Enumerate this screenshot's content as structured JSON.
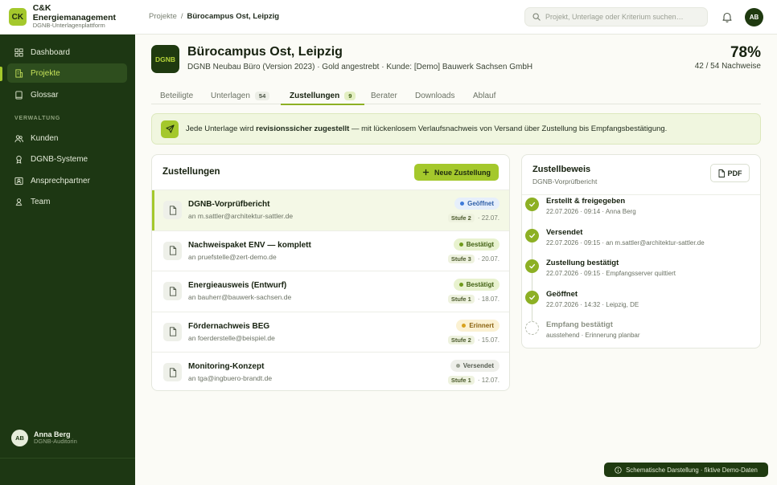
{
  "brand": {
    "logo": "CK",
    "name": "C&K Energiemanagement",
    "subtitle": "DGNB-Unterlagenplattform"
  },
  "breadcrumb": {
    "parent": "Projekte",
    "separator": "/",
    "current": "Bürocampus Ost, Leipzig"
  },
  "search": {
    "placeholder": "Projekt, Unterlage oder Kriterium suchen…",
    "icon": "search-icon"
  },
  "topbar": {
    "avatar": "AB",
    "bell_icon": "bell-icon"
  },
  "sidebar": {
    "items": [
      {
        "label": "Dashboard",
        "icon": "grid-icon"
      },
      {
        "label": "Projekte",
        "icon": "building-icon",
        "active": true
      },
      {
        "label": "Glossar",
        "icon": "book-icon"
      }
    ],
    "section_label": "VERWALTUNG",
    "admin_items": [
      {
        "label": "Kunden",
        "icon": "users-icon"
      },
      {
        "label": "DGNB-Systeme",
        "icon": "award-icon"
      },
      {
        "label": "Ansprechpartner",
        "icon": "contact-card-icon"
      },
      {
        "label": "Team",
        "icon": "user-icon"
      }
    ],
    "user": {
      "initials": "AB",
      "name": "Anna Berg",
      "role": "DGNB-Auditorin"
    }
  },
  "project": {
    "logo": "DGNB",
    "title": "Bürocampus Ost, Leipzig",
    "subtitle": "DGNB Neubau Büro (Version 2023) · Gold angestrebt · Kunde: [Demo] Bauwerk Sachsen GmbH",
    "progress_pct": "78%",
    "progress_value": 0.78,
    "progress_count": "42 / 54 Nachweise"
  },
  "tabs": [
    {
      "label": "Beteiligte",
      "count": ""
    },
    {
      "label": "Unterlagen",
      "count": "54"
    },
    {
      "label": "Zustellungen",
      "count": "9",
      "active": true
    },
    {
      "label": "Berater",
      "count": ""
    },
    {
      "label": "Downloads",
      "count": ""
    },
    {
      "label": "Ablauf",
      "count": ""
    }
  ],
  "banner": {
    "icon": "send-icon",
    "text_before": "Jede Unterlage wird ",
    "text_bold": "revisionssicher zugestellt",
    "text_after": " — mit lückenlosem Verlaufsnachweis von Versand über Zustellung bis Empfangsbestätigung."
  },
  "deliveries": {
    "title": "Zustellungen",
    "new_button": "Neue Zustellung",
    "rows": [
      {
        "title": "DGNB-Vorprüfbericht",
        "recipient": "an m.sattler@architektur-sattler.de",
        "status": "Geöffnet",
        "status_color": "#3f7bd8",
        "status_bg": "#e6effb",
        "status_text": "#2f5fa8",
        "stage": "Stufe 2",
        "date": "· 22.07.",
        "selected": true
      },
      {
        "title": "Nachweispaket ENV — komplett",
        "recipient": "an pruefstelle@zert-demo.de",
        "status": "Bestätigt",
        "status_color": "#6f9a1a",
        "status_bg": "#e8f2cf",
        "status_text": "#3f5f10",
        "stage": "Stufe 3",
        "date": "· 20.07."
      },
      {
        "title": "Energieausweis (Entwurf)",
        "recipient": "an bauherr@bauwerk-sachsen.de",
        "status": "Bestätigt",
        "status_color": "#6f9a1a",
        "status_bg": "#e8f2cf",
        "status_text": "#3f5f10",
        "stage": "Stufe 1",
        "date": "· 18.07."
      },
      {
        "title": "Fördernachweis BEG",
        "recipient": "an foerderstelle@beispiel.de",
        "status": "Erinnert",
        "status_color": "#d8a21f",
        "status_bg": "#fbf1d2",
        "status_text": "#8a6210",
        "stage": "Stufe 2",
        "date": "· 15.07."
      },
      {
        "title": "Monitoring-Konzept",
        "recipient": "an tga@ingbuero-brandt.de",
        "status": "Versendet",
        "status_color": "#9aa093",
        "status_bg": "#eeefea",
        "status_text": "#585f53",
        "stage": "Stufe 1",
        "date": "· 12.07."
      }
    ]
  },
  "proof": {
    "title": "Zustellbeweis",
    "subtitle": "DGNB-Vorprüfbericht",
    "pdf_button": "PDF",
    "steps": [
      {
        "title": "Erstellt & freigegeben",
        "detail": "22.07.2026 · 09:14 · Anna Berg",
        "done": true
      },
      {
        "title": "Versendet",
        "detail": "22.07.2026 · 09:15 · an m.sattler@architektur-sattler.de",
        "done": true
      },
      {
        "title": "Zustellung bestätigt",
        "detail": "22.07.2026 · 09:15 · Empfangsserver quittiert",
        "done": true
      },
      {
        "title": "Geöffnet",
        "detail": "22.07.2026 · 14:32 · Leipzig, DE",
        "done": true
      },
      {
        "title": "Empfang bestätigt",
        "detail": "ausstehend · Erinnerung planbar",
        "done": false
      }
    ]
  },
  "footer_badge": {
    "icon": "info-icon",
    "text": "Schematische Darstellung · fiktive Demo-Daten"
  },
  "colors": {
    "accent": "#a4c82c",
    "sidebar": "#1d3713",
    "dark": "#1f3a10"
  }
}
